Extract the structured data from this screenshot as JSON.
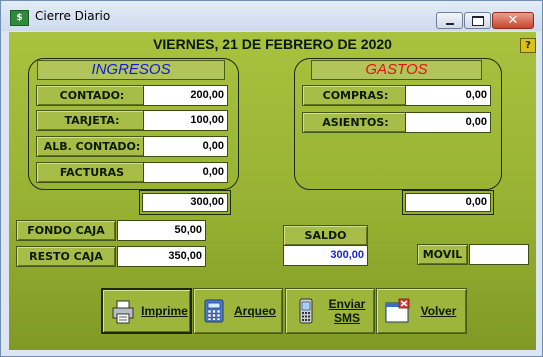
{
  "window": {
    "title": "Cierre Diario",
    "help_label": "?"
  },
  "date_header": "VIERNES, 21 DE FEBRERO DE 2020",
  "ingresos": {
    "title": "INGRESOS",
    "title_color": "#0f1ad9",
    "rows": [
      {
        "label": "CONTADO:",
        "value": "200,00"
      },
      {
        "label": "TARJETA:",
        "value": "100,00"
      },
      {
        "label": "ALB. CONTADO:",
        "value": "0,00"
      },
      {
        "label": "FACTURAS",
        "value": "0,00"
      }
    ],
    "total": "300,00"
  },
  "gastos": {
    "title": "GASTOS",
    "title_color": "#e01414",
    "rows": [
      {
        "label": "COMPRAS:",
        "value": "0,00"
      },
      {
        "label": "ASIENTOS:",
        "value": "0,00"
      }
    ],
    "total": "0,00"
  },
  "caja": {
    "fondo_label": "FONDO CAJA",
    "fondo_value": "50,00",
    "resto_label": "RESTO CAJA",
    "resto_value": "350,00"
  },
  "saldo": {
    "label": "SALDO",
    "value": "300,00"
  },
  "movil": {
    "label": "MOVIL",
    "value": ""
  },
  "buttons": {
    "imprime": "Imprime",
    "arqueo": "Arqueo",
    "enviar_sms_line1": "Enviar",
    "enviar_sms_line2": "SMS",
    "volver": "Volver"
  },
  "icons": {
    "app": "app-icon",
    "imprime": "printer-icon",
    "arqueo": "calculator-icon",
    "enviar_sms": "mobile-phone-icon",
    "volver": "close-window-icon"
  }
}
